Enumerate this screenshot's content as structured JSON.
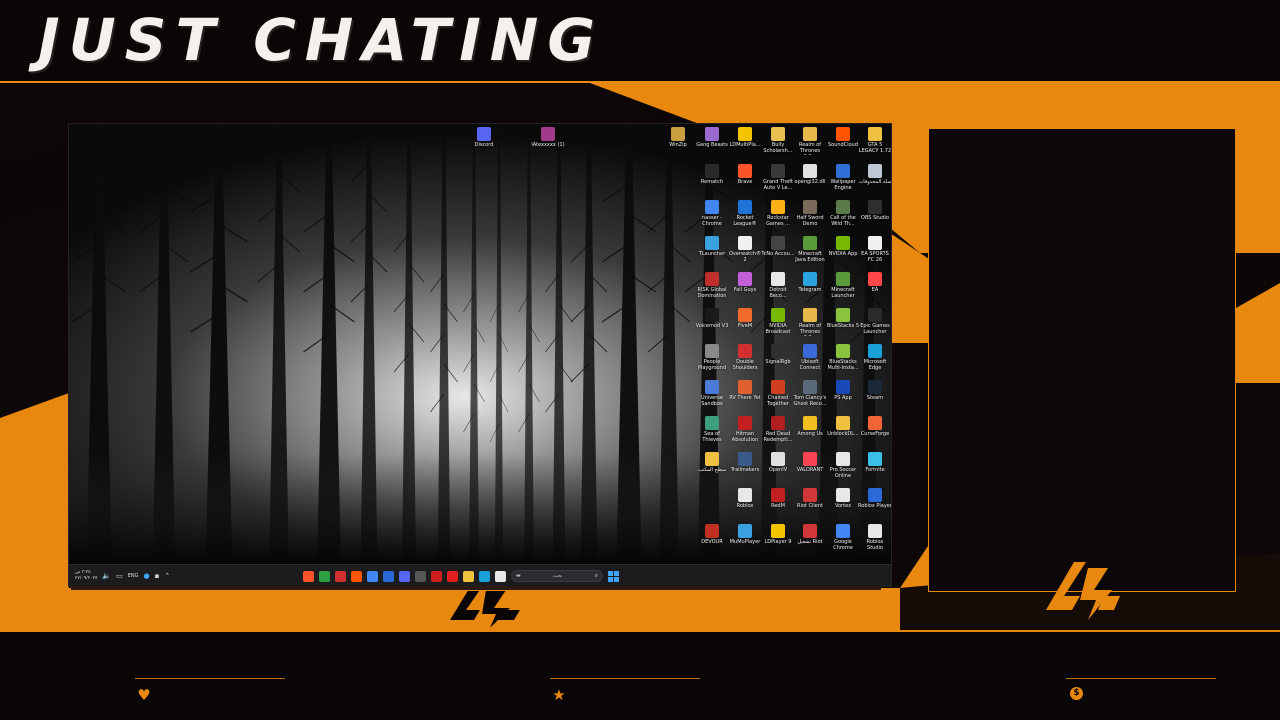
{
  "overlay": {
    "title": "JUST CHATING",
    "accent_color": "#e8880f",
    "background_color": "#0b0706",
    "logo_icon": "lightning-logo-icon",
    "stats": [
      {
        "icon": "heart-icon",
        "glyph": "♥",
        "value": ""
      },
      {
        "icon": "star-icon",
        "glyph": "★",
        "value": ""
      },
      {
        "icon": "coin-icon",
        "glyph": "$",
        "value": ""
      }
    ]
  },
  "desktop": {
    "top_icons": [
      {
        "label": "Discord",
        "icon": "discord-icon",
        "color": "#5865f2"
      },
      {
        "label": "iAtexxxxx (1)",
        "icon": "archive-icon",
        "color": "#a03a8a"
      }
    ],
    "grid_icons": [
      {
        "label": "WinZip",
        "color": "#c8a040"
      },
      {
        "label": "Gang Beasts",
        "color": "#9a6ad0"
      },
      {
        "label": "LDMultiPla...",
        "color": "#f5c400"
      },
      {
        "label": "Bully Scholarsh...",
        "color": "#e8c050"
      },
      {
        "label": "Realm of Thrones 6.2...",
        "color": "#e8b84a"
      },
      {
        "label": "SoundCloud",
        "color": "#ff5500"
      },
      {
        "label": "GTA 5 LEGACY 1.72",
        "color": "#f0c040"
      },
      {
        "label": "Rematch",
        "color": "#2a2a2a"
      },
      {
        "label": "Brave",
        "color": "#fb542b"
      },
      {
        "label": "Grand Theft Auto V Le...",
        "color": "#3a3a3a"
      },
      {
        "label": "opengl32.dll",
        "color": "#e0e0e0"
      },
      {
        "label": "Wallpaper Engine",
        "color": "#2f6fd6"
      },
      {
        "label": "سلة المحذوفات",
        "color": "#bfc7d2"
      },
      {
        "label": "nasser - Chrome",
        "color": "#4285f4"
      },
      {
        "label": "Rocket League®",
        "color": "#1e73d8"
      },
      {
        "label": "Rockstar Games ...",
        "color": "#fcaf17"
      },
      {
        "label": "Half Sword Demo",
        "color": "#7a6a5a"
      },
      {
        "label": "Call of the Wild Th...",
        "color": "#5a7a4a"
      },
      {
        "label": "OBS Studio",
        "color": "#302e31"
      },
      {
        "label": "TLauncher",
        "color": "#3aa0e0"
      },
      {
        "label": "Overwatch® 2",
        "color": "#f0f0f0"
      },
      {
        "label": "TcNo Accou...",
        "color": "#444"
      },
      {
        "label": "Minecraft Java Edition",
        "color": "#5a9a3a"
      },
      {
        "label": "NVIDIA App",
        "color": "#76b900"
      },
      {
        "label": "EA SPORTS FC 26",
        "color": "#f0f0f0"
      },
      {
        "label": "RISK Global Domination",
        "color": "#c0302a"
      },
      {
        "label": "Fall Guys",
        "color": "#c35fd8"
      },
      {
        "label": "Detroit Beco...",
        "color": "#e8e8e8"
      },
      {
        "label": "Telegram",
        "color": "#2aa3e0"
      },
      {
        "label": "Minecraft Launcher",
        "color": "#5a9a3a"
      },
      {
        "label": "EA",
        "color": "#ff4747"
      },
      {
        "label": "Voicemod V3",
        "color": "#1a1a1a"
      },
      {
        "label": "FiveM",
        "color": "#f26a29"
      },
      {
        "label": "NVIDIA Broadcast",
        "color": "#76b900"
      },
      {
        "label": "Realm of Thrones 6.2...",
        "color": "#e8b84a"
      },
      {
        "label": "BlueStacks 5",
        "color": "#8ac43f"
      },
      {
        "label": "Epic Games Launcher",
        "color": "#2a2a2a"
      },
      {
        "label": "People Playground",
        "color": "#8a8a8a"
      },
      {
        "label": "Double Shoulders",
        "color": "#d03030"
      },
      {
        "label": "SignalRgb",
        "color": "#303030"
      },
      {
        "label": "Ubisoft Connect",
        "color": "#3a6ad8"
      },
      {
        "label": "BlueStacks Multi-Insta...",
        "color": "#8ac43f"
      },
      {
        "label": "Microsoft Edge",
        "color": "#1aa0d8"
      },
      {
        "label": "Universe Sandbox",
        "color": "#4a7ad8"
      },
      {
        "label": "RV There Yet",
        "color": "#e06030"
      },
      {
        "label": "Chained Together",
        "color": "#d04020"
      },
      {
        "label": "Tom Clancy's Ghost Reco...",
        "color": "#5a6a7a"
      },
      {
        "label": "PS App",
        "color": "#1a4ab8"
      },
      {
        "label": "Steam",
        "color": "#1b2838"
      },
      {
        "label": "Sea of Thieves",
        "color": "#3aa080"
      },
      {
        "label": "Hitman Absolution",
        "color": "#c02020"
      },
      {
        "label": "Red Dead Redempti...",
        "color": "#b02020"
      },
      {
        "label": "Among Us",
        "color": "#f0c020"
      },
      {
        "label": "UnblockDL...",
        "color": "#f0c040"
      },
      {
        "label": "CurseForge",
        "color": "#f16436"
      },
      {
        "label": "سطح المكتب",
        "color": "#f0c040"
      },
      {
        "label": "Trailmakers",
        "color": "#3a5a8a"
      },
      {
        "label": "OpenIV",
        "color": "#e0e0e0"
      },
      {
        "label": "VALORANT",
        "color": "#fa4454"
      },
      {
        "label": "Pro Soccer Online",
        "color": "#e8e8e8"
      },
      {
        "label": "Fortnite",
        "color": "#3ac0e8"
      },
      {
        "label": "Roblox",
        "color": "#e8e8e8"
      },
      {
        "label": "RedM",
        "color": "#c02020"
      },
      {
        "label": "Riot Client",
        "color": "#d13639"
      },
      {
        "label": "Vortex",
        "color": "#e8e8e8"
      },
      {
        "label": "Roblox Player",
        "color": "#2a6ad8"
      },
      {
        "label": "DEVOUR",
        "color": "#c03020"
      },
      {
        "label": "MuMuPlayer",
        "color": "#3aa0e0"
      },
      {
        "label": "LDPlayer 9",
        "color": "#f5c400"
      },
      {
        "label": "تشغيل Riot",
        "color": "#d13639"
      },
      {
        "label": "Google Chrome",
        "color": "#4285f4"
      },
      {
        "label": "Roblox Studio",
        "color": "#e8e8e8"
      }
    ]
  },
  "taskbar": {
    "clock_line1": "٣:٢٥ ص",
    "clock_line2": "٢٧/٠٩/٢٠٢٥",
    "language": "ENG",
    "search_placeholder": "بحث",
    "apps": [
      {
        "icon": "brave-icon",
        "color": "#fb542b"
      },
      {
        "icon": "xbox-icon",
        "color": "#2ea043"
      },
      {
        "icon": "app-icon",
        "color": "#d03030"
      },
      {
        "icon": "soundcloud-icon",
        "color": "#ff5500"
      },
      {
        "icon": "chrome-icon",
        "color": "#4285f4"
      },
      {
        "icon": "steam-icon",
        "color": "#2a6ad8"
      },
      {
        "icon": "discord-icon",
        "color": "#5865f2"
      },
      {
        "icon": "obs-icon",
        "color": "#555555"
      },
      {
        "icon": "record-icon",
        "color": "#cc2020"
      },
      {
        "icon": "youtube-icon",
        "color": "#e02020"
      },
      {
        "icon": "file-explorer-icon",
        "color": "#f0c040"
      },
      {
        "icon": "edge-icon",
        "color": "#1aa0d8"
      },
      {
        "icon": "store-icon",
        "color": "#e8e8e8"
      }
    ]
  }
}
